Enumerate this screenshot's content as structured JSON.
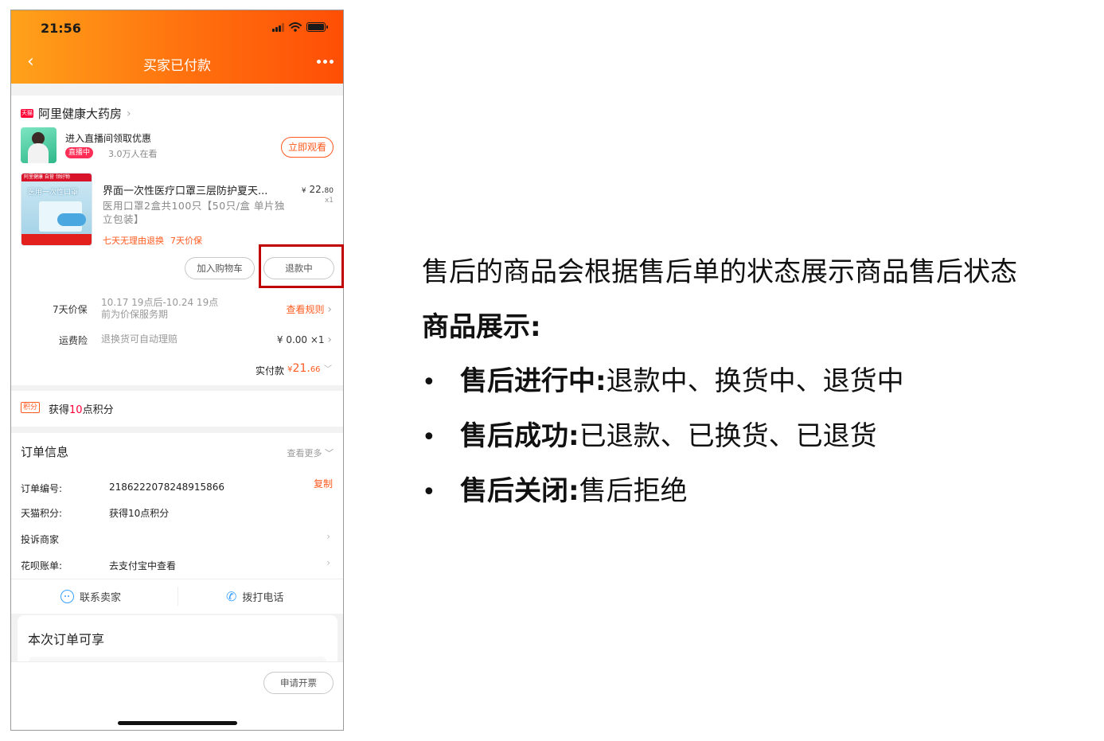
{
  "status_bar": {
    "time": "21:56"
  },
  "nav": {
    "back_glyph": "‹",
    "title": "买家已付款"
  },
  "shop": {
    "logo_text": "天猫",
    "name": "阿里健康大药房"
  },
  "live": {
    "title": "进入直播间领取优惠",
    "badge": "直播中",
    "viewers": "3.0万人在看",
    "watch_button": "立即观看"
  },
  "product": {
    "image_band": "阿里健康 自营 领好物",
    "image_label": "医用一次性口罩",
    "title": "界面一次性医疗口罩三层防护夏天...",
    "price_currency": "¥",
    "price_int": "22.",
    "price_dec": "80",
    "quantity": "x1",
    "spec": "医用口罩2盒共100只【50只/盒 单片独立包装】",
    "tags": [
      "七天无理由退换",
      "7天价保"
    ],
    "buttons": {
      "add_cart": "加入购物车",
      "refund_status": "退款中"
    }
  },
  "price_protect": {
    "label": "7天价保",
    "line1": "10.17 19点后-10.24 19点",
    "line2": "前为价保服务期",
    "link": "查看规则"
  },
  "shipping_insurance": {
    "label": "运费险",
    "desc": "退换货可自动理赔",
    "value": "¥ 0.00 ×1"
  },
  "payment": {
    "label": "实付款",
    "currency": "¥",
    "int": "21.",
    "dec": "66"
  },
  "points": {
    "badge": "积分",
    "prefix": "获得",
    "count": "10",
    "suffix": "点积分"
  },
  "order_info": {
    "title": "订单信息",
    "more": "查看更多",
    "rows": [
      {
        "key": "订单编号:",
        "value": "2186222078248915866",
        "action": "复制"
      },
      {
        "key": "天猫积分:",
        "value": "获得10点积分"
      },
      {
        "key": "投诉商家",
        "value": ""
      },
      {
        "key": "花呗账单:",
        "value": "去支付宝中查看"
      }
    ],
    "contact_seller": "联系卖家",
    "call_phone": "拨打电话"
  },
  "benefits": {
    "title": "本次订单可享"
  },
  "bottom": {
    "invoice_button": "申请开票"
  },
  "annotation": {
    "intro": "售后的商品会根据售后单的状态展示商品售后状态",
    "heading": "商品展示:",
    "bullets": [
      {
        "bold": "售后进行中:",
        "text": "退款中、换货中、退货中"
      },
      {
        "bold": "售后成功:",
        "text": "已退款、已换货、已退货"
      },
      {
        "bold": "售后关闭:",
        "text": "售后拒绝"
      }
    ]
  },
  "colors": {
    "accent": "#ff5a1f",
    "highlight": "#c00000",
    "header_start": "#ffa21a",
    "header_end": "#ff4f06"
  }
}
